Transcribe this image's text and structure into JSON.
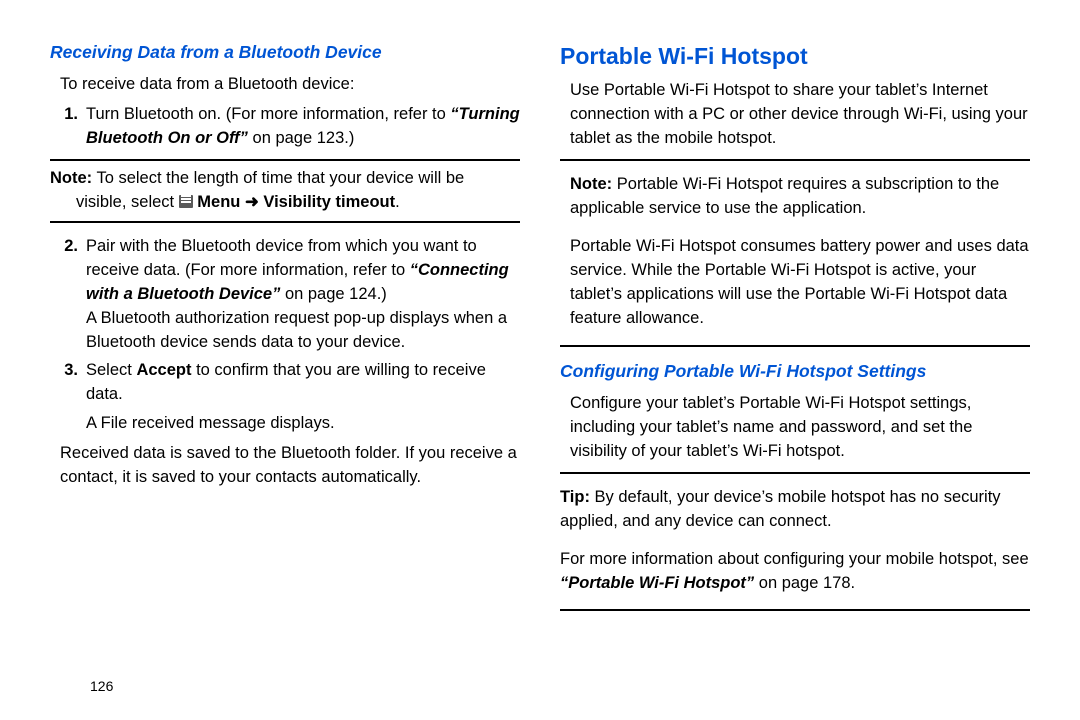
{
  "pageNumber": "126",
  "left": {
    "subheading": "Receiving Data from a Bluetooth Device",
    "intro": "To receive data from a Bluetooth device:",
    "step1_pre": "Turn Bluetooth on. (For more information, refer to ",
    "step1_ref": "“Turning Bluetooth On or Off”",
    "step1_post": " on page 123.)",
    "note1_label": "Note:",
    "note1_a": " To select the length of time that your device will be ",
    "note1_b": "visible, select ",
    "note1_menu": " Menu ",
    "note1_arrow": "➜",
    "note1_vis": " Visibility timeout",
    "note1_dot": ".",
    "step2_a": "Pair with the Bluetooth device from which you want to receive data. (For more information, refer to ",
    "step2_ref": "“Connecting with a Bluetooth Device”",
    "step2_b": " on page 124.)",
    "step2_c": "A Bluetooth authorization request pop-up displays when a Bluetooth device sends data to your device.",
    "step3_a": "Select ",
    "step3_accept": "Accept",
    "step3_b": " to confirm that you are willing to receive data.",
    "step3_c": "A File received message displays.",
    "tail": "Received data is saved to the Bluetooth folder. If you receive a contact, it is saved to your contacts automatically."
  },
  "right": {
    "heading": "Portable Wi-Fi Hotspot",
    "intro": "Use Portable Wi-Fi Hotspot to share your tablet’s Internet connection with a PC or other device through Wi-Fi, using your tablet as the mobile hotspot.",
    "note_label": "Note:",
    "note_a": " Portable Wi-Fi Hotspot requires a subscription to the applicable service to use the application.",
    "note_b": "Portable Wi-Fi Hotspot consumes battery power and uses data service. While the Portable Wi-Fi Hotspot is active, your tablet’s applications will use the Portable Wi-Fi Hotspot data feature allowance.",
    "subheading": "Configuring Portable Wi-Fi Hotspot Settings",
    "conf_intro": "Configure your tablet’s Portable Wi-Fi Hotspot settings, including your tablet’s name and password, and set the visibility of your tablet’s Wi-Fi hotspot.",
    "tip_label": "Tip:",
    "tip_a": " By default, your device’s mobile hotspot has no security applied, and any device can connect.",
    "tip_b_pre": "For more information about configuring your mobile hotspot, see ",
    "tip_b_ref": "“Portable Wi-Fi Hotspot”",
    "tip_b_post": " on page 178."
  }
}
